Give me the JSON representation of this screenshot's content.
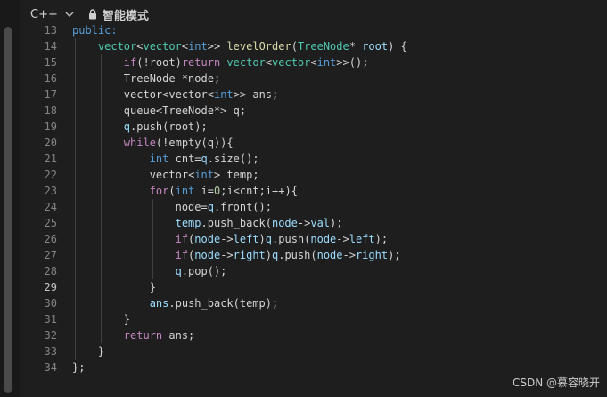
{
  "toolbar": {
    "language": "C++",
    "mode_label": "智能模式"
  },
  "watermark": "CSDN @慕容晓开",
  "code": {
    "active_line": 29,
    "lines": [
      {
        "n": 13,
        "tokens": [
          {
            "t": "public:",
            "c": "blue"
          }
        ]
      },
      {
        "n": 14,
        "tokens": [
          {
            "t": "    vector",
            "c": "ty"
          },
          {
            "t": "<",
            "c": "plain"
          },
          {
            "t": "vector",
            "c": "ty"
          },
          {
            "t": "<",
            "c": "plain"
          },
          {
            "t": "int",
            "c": "blue"
          },
          {
            "t": ">> ",
            "c": "plain"
          },
          {
            "t": "levelOrder",
            "c": "fn"
          },
          {
            "t": "(",
            "c": "plain"
          },
          {
            "t": "TreeNode",
            "c": "ty"
          },
          {
            "t": "* ",
            "c": "plain"
          },
          {
            "t": "root",
            "c": "var"
          },
          {
            "t": ") {",
            "c": "plain"
          }
        ]
      },
      {
        "n": 15,
        "tokens": [
          {
            "t": "        ",
            "c": "plain"
          },
          {
            "t": "if",
            "c": "kw"
          },
          {
            "t": "(!root)",
            "c": "plain"
          },
          {
            "t": "return",
            "c": "kw"
          },
          {
            "t": " ",
            "c": "plain"
          },
          {
            "t": "vector",
            "c": "ty"
          },
          {
            "t": "<",
            "c": "plain"
          },
          {
            "t": "vector",
            "c": "ty"
          },
          {
            "t": "<",
            "c": "plain"
          },
          {
            "t": "int",
            "c": "blue"
          },
          {
            "t": ">>();",
            "c": "plain"
          }
        ]
      },
      {
        "n": 16,
        "tokens": [
          {
            "t": "        ",
            "c": "plain"
          },
          {
            "t": "TreeNode",
            "c": "plain"
          },
          {
            "t": " *node;",
            "c": "plain"
          }
        ]
      },
      {
        "n": 17,
        "tokens": [
          {
            "t": "        ",
            "c": "plain"
          },
          {
            "t": "vector",
            "c": "plain"
          },
          {
            "t": "<",
            "c": "plain"
          },
          {
            "t": "vector",
            "c": "plain"
          },
          {
            "t": "<",
            "c": "plain"
          },
          {
            "t": "int",
            "c": "blue"
          },
          {
            "t": ">> ans;",
            "c": "plain"
          }
        ]
      },
      {
        "n": 18,
        "tokens": [
          {
            "t": "        ",
            "c": "plain"
          },
          {
            "t": "queue",
            "c": "plain"
          },
          {
            "t": "<",
            "c": "plain"
          },
          {
            "t": "TreeNode",
            "c": "plain"
          },
          {
            "t": "*> q;",
            "c": "plain"
          }
        ]
      },
      {
        "n": 19,
        "tokens": [
          {
            "t": "        ",
            "c": "plain"
          },
          {
            "t": "q",
            "c": "var"
          },
          {
            "t": ".push(root);",
            "c": "plain"
          }
        ]
      },
      {
        "n": 20,
        "tokens": [
          {
            "t": "        ",
            "c": "plain"
          },
          {
            "t": "while",
            "c": "kw"
          },
          {
            "t": "(!empty(q)){",
            "c": "plain"
          }
        ]
      },
      {
        "n": 21,
        "tokens": [
          {
            "t": "            ",
            "c": "plain"
          },
          {
            "t": "int",
            "c": "blue"
          },
          {
            "t": " cnt=",
            "c": "plain"
          },
          {
            "t": "q",
            "c": "var"
          },
          {
            "t": ".size();",
            "c": "plain"
          }
        ]
      },
      {
        "n": 22,
        "tokens": [
          {
            "t": "            ",
            "c": "plain"
          },
          {
            "t": "vector",
            "c": "plain"
          },
          {
            "t": "<",
            "c": "plain"
          },
          {
            "t": "int",
            "c": "blue"
          },
          {
            "t": "> temp;",
            "c": "plain"
          }
        ]
      },
      {
        "n": 23,
        "tokens": [
          {
            "t": "            ",
            "c": "plain"
          },
          {
            "t": "for",
            "c": "kw"
          },
          {
            "t": "(",
            "c": "plain"
          },
          {
            "t": "int",
            "c": "blue"
          },
          {
            "t": " i=",
            "c": "plain"
          },
          {
            "t": "0",
            "c": "num"
          },
          {
            "t": ";i<cnt;i++){",
            "c": "plain"
          }
        ]
      },
      {
        "n": 24,
        "tokens": [
          {
            "t": "                ",
            "c": "plain"
          },
          {
            "t": "node=",
            "c": "plain"
          },
          {
            "t": "q",
            "c": "var"
          },
          {
            "t": ".front();",
            "c": "plain"
          }
        ]
      },
      {
        "n": 25,
        "tokens": [
          {
            "t": "                ",
            "c": "plain"
          },
          {
            "t": "temp",
            "c": "var"
          },
          {
            "t": ".push_back(",
            "c": "plain"
          },
          {
            "t": "node",
            "c": "var"
          },
          {
            "t": "->",
            "c": "plain"
          },
          {
            "t": "val",
            "c": "var"
          },
          {
            "t": ");",
            "c": "plain"
          }
        ]
      },
      {
        "n": 26,
        "tokens": [
          {
            "t": "                ",
            "c": "plain"
          },
          {
            "t": "if",
            "c": "kw"
          },
          {
            "t": "(",
            "c": "plain"
          },
          {
            "t": "node",
            "c": "var"
          },
          {
            "t": "->",
            "c": "plain"
          },
          {
            "t": "left",
            "c": "var"
          },
          {
            "t": ")",
            "c": "plain"
          },
          {
            "t": "q",
            "c": "var"
          },
          {
            "t": ".push(",
            "c": "plain"
          },
          {
            "t": "node",
            "c": "var"
          },
          {
            "t": "->",
            "c": "plain"
          },
          {
            "t": "left",
            "c": "var"
          },
          {
            "t": ");",
            "c": "plain"
          }
        ]
      },
      {
        "n": 27,
        "tokens": [
          {
            "t": "                ",
            "c": "plain"
          },
          {
            "t": "if",
            "c": "kw"
          },
          {
            "t": "(",
            "c": "plain"
          },
          {
            "t": "node",
            "c": "var"
          },
          {
            "t": "->",
            "c": "plain"
          },
          {
            "t": "right",
            "c": "var"
          },
          {
            "t": ")",
            "c": "plain"
          },
          {
            "t": "q",
            "c": "var"
          },
          {
            "t": ".push(",
            "c": "plain"
          },
          {
            "t": "node",
            "c": "var"
          },
          {
            "t": "->",
            "c": "plain"
          },
          {
            "t": "right",
            "c": "var"
          },
          {
            "t": ");",
            "c": "plain"
          }
        ]
      },
      {
        "n": 28,
        "tokens": [
          {
            "t": "                ",
            "c": "plain"
          },
          {
            "t": "q",
            "c": "var"
          },
          {
            "t": ".pop();",
            "c": "plain"
          }
        ]
      },
      {
        "n": 29,
        "tokens": [
          {
            "t": "            }",
            "c": "plain"
          }
        ]
      },
      {
        "n": 30,
        "tokens": [
          {
            "t": "            ",
            "c": "plain"
          },
          {
            "t": "ans",
            "c": "var"
          },
          {
            "t": ".push_back(temp);",
            "c": "plain"
          }
        ]
      },
      {
        "n": 31,
        "tokens": [
          {
            "t": "        }",
            "c": "plain"
          }
        ]
      },
      {
        "n": 32,
        "tokens": [
          {
            "t": "        ",
            "c": "plain"
          },
          {
            "t": "return",
            "c": "kw"
          },
          {
            "t": " ans;",
            "c": "plain"
          }
        ]
      },
      {
        "n": 33,
        "tokens": [
          {
            "t": "    }",
            "c": "plain"
          }
        ]
      },
      {
        "n": 34,
        "tokens": [
          {
            "t": "};",
            "c": "plain"
          }
        ]
      }
    ]
  }
}
